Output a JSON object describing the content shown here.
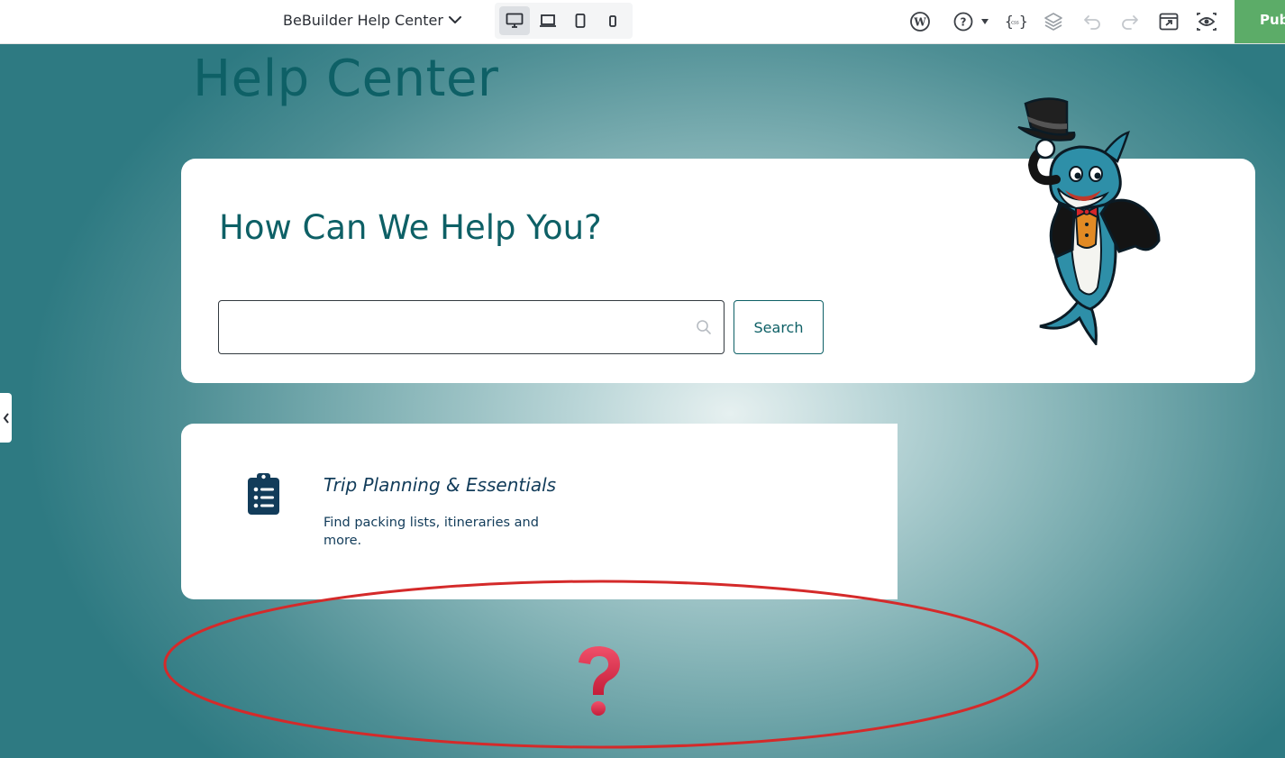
{
  "topbar": {
    "site_title": "BeBuilder Help Center",
    "devices": [
      "desktop",
      "laptop",
      "tablet",
      "mobile"
    ],
    "active_device": "desktop",
    "publish_label": "Pub",
    "accent_color": "#5cac68"
  },
  "page": {
    "title": "Help Center",
    "search_card": {
      "heading": "How Can We Help You?",
      "input_value": "",
      "button_label": "Search"
    },
    "category": {
      "title": "Trip Planning & Essentials",
      "description": "Find packing lists, itineraries and more.",
      "icon": "clipboard-list-icon"
    }
  },
  "annotation": {
    "shape": "ellipse",
    "color": "#d42a2a",
    "symbol": "question-mark",
    "symbol_color": "#e8324e"
  },
  "colors": {
    "brand_teal": "#0e6066",
    "navy": "#123c5a"
  }
}
